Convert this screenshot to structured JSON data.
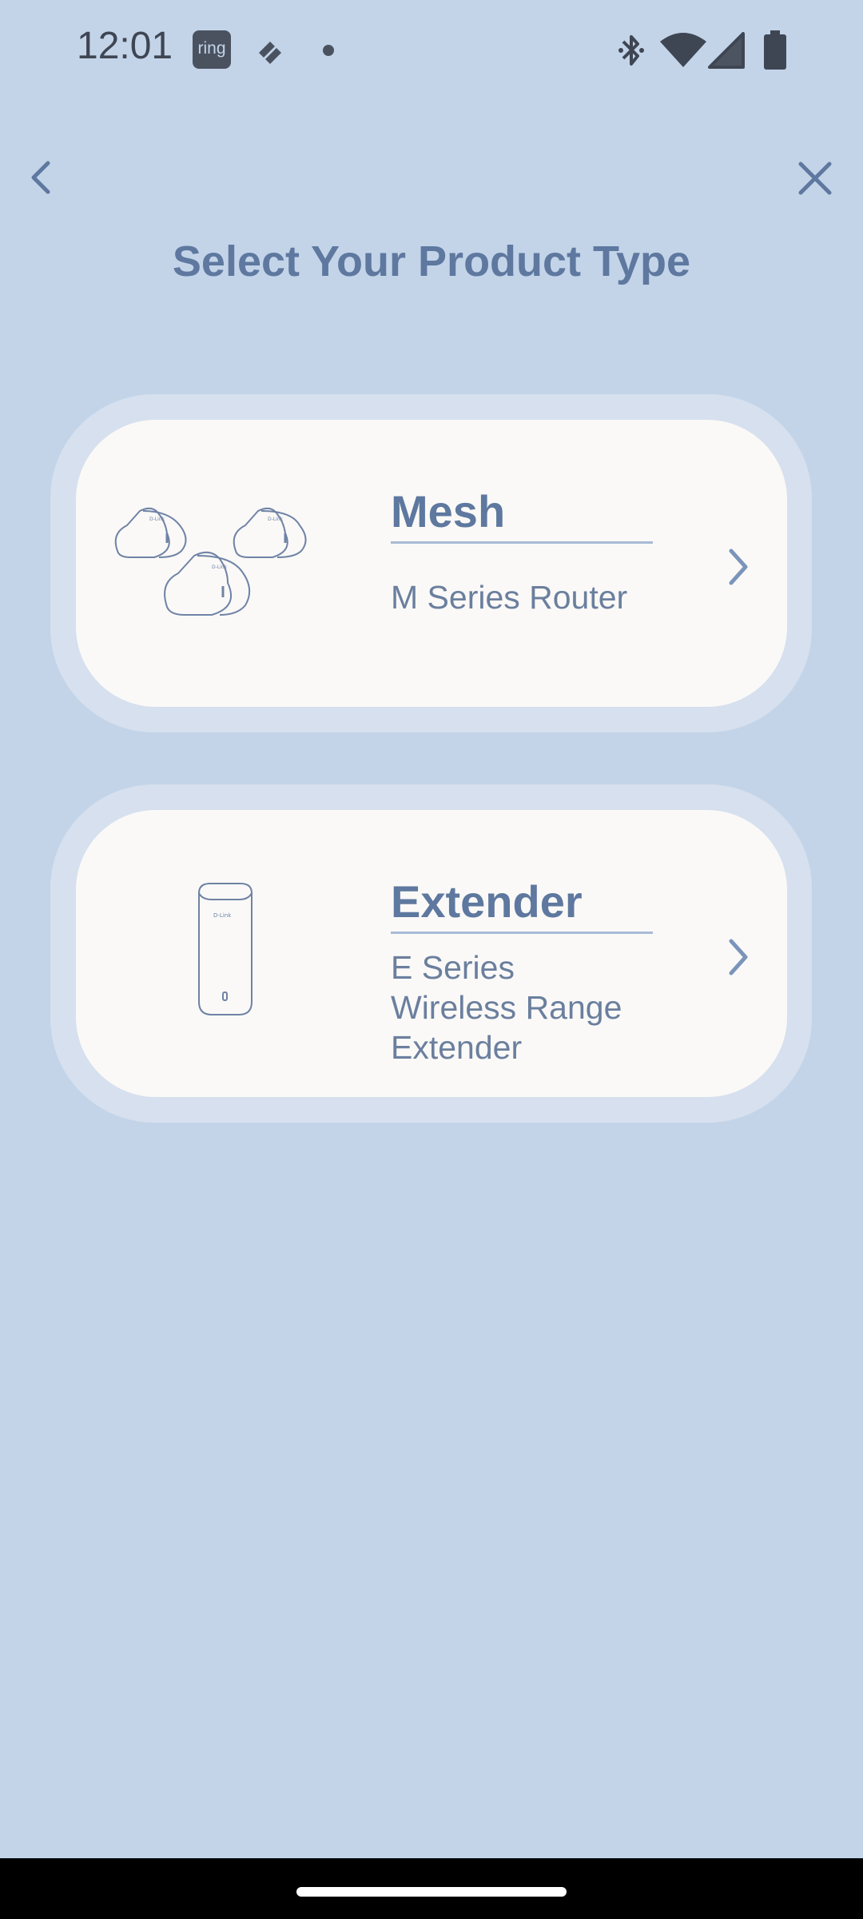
{
  "status_bar": {
    "time": "12:01",
    "ring_label": "ring",
    "left_icons": [
      "ring-app-icon",
      "stripe-app-icon",
      "notification-dot-icon"
    ],
    "right_icons": [
      "bluetooth-icon",
      "wifi-icon",
      "cell-signal-icon",
      "battery-icon"
    ]
  },
  "nav": {
    "back_icon": "chevron-left-icon",
    "close_icon": "close-icon"
  },
  "page": {
    "title": "Select Your Product Type"
  },
  "products": [
    {
      "title": "Mesh",
      "subtitle": "M Series Router",
      "illustration": "mesh-routers-illustration",
      "chevron_icon": "chevron-right-icon"
    },
    {
      "title": "Extender",
      "subtitle": "E Series Wireless Range Extender",
      "illustration": "range-extender-illustration",
      "chevron_icon": "chevron-right-icon"
    }
  ],
  "colors": {
    "background": "#c3d4e9",
    "card_outer": "#d6e0ee",
    "card_inner": "#faf9f7",
    "accent": "#5e789f",
    "text_secondary": "#6b7f9e",
    "nav_bar": "#000000"
  }
}
